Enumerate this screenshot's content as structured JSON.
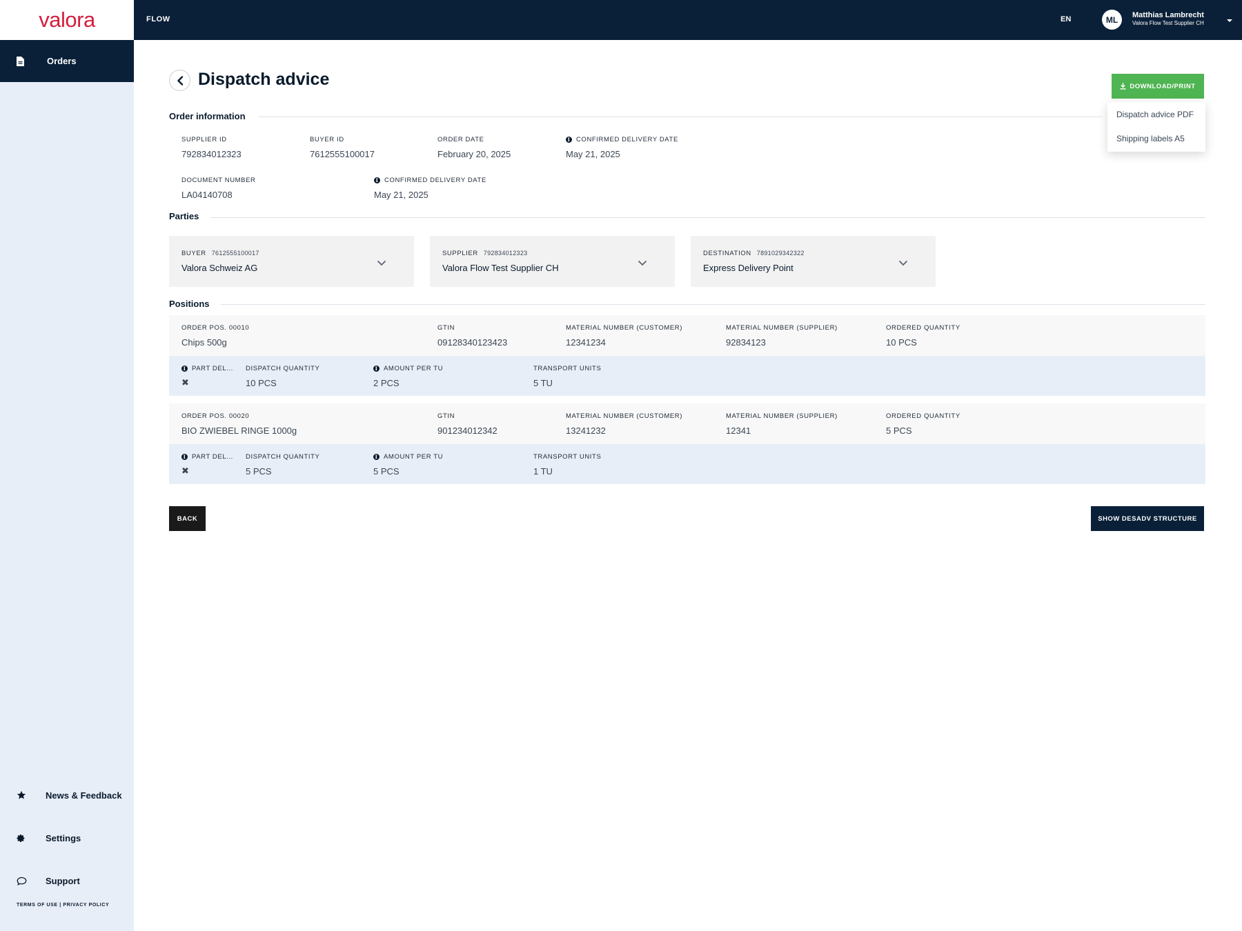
{
  "app": {
    "brand": "valora",
    "section": "FLOW",
    "language": "EN"
  },
  "user": {
    "initials": "ML",
    "name": "Matthias Lambrecht",
    "org": "Valora Flow Test Supplier CH"
  },
  "sidebar": {
    "orders": "Orders",
    "news": "News & Feedback",
    "settings": "Settings",
    "support": "Support",
    "terms": "TERMS OF USE",
    "separator": "|",
    "privacy": "PRIVACY POLICY"
  },
  "page": {
    "title": "Dispatch advice",
    "download_label": "DOWNLOAD/PRINT",
    "dropdown": [
      "Dispatch advice PDF",
      "Shipping labels A5"
    ]
  },
  "order_info": {
    "section_title": "Order information",
    "supplier_id_label": "SUPPLIER ID",
    "supplier_id": "792834012323",
    "buyer_id_label": "BUYER ID",
    "buyer_id": "7612555100017",
    "order_date_label": "ORDER DATE",
    "order_date": "February 20, 2025",
    "confirmed_delivery_label": "CONFIRMED DELIVERY DATE",
    "confirmed_delivery": "May 21, 2025",
    "document_number_label": "DOCUMENT NUMBER",
    "document_number": "LA04140708",
    "confirmed_delivery_label_2": "CONFIRMED DELIVERY DATE",
    "confirmed_delivery_2": "May 21, 2025"
  },
  "parties": {
    "section_title": "Parties",
    "items": [
      {
        "role": "BUYER",
        "id": "7612555100017",
        "name": "Valora Schweiz AG"
      },
      {
        "role": "SUPPLIER",
        "id": "792834012323",
        "name": "Valora Flow Test Supplier CH"
      },
      {
        "role": "DESTINATION",
        "id": "7891029342322",
        "name": "Express Delivery Point"
      }
    ]
  },
  "positions": {
    "section_title": "Positions",
    "labels": {
      "gtin": "GTIN",
      "mat_customer": "MATERIAL NUMBER (CUSTOMER)",
      "mat_supplier": "MATERIAL NUMBER (SUPPLIER)",
      "ordered_qty": "ORDERED QUANTITY",
      "part_delivery": "PART DEL...",
      "dispatch_qty": "DISPATCH QUANTITY",
      "amount_per_tu": "AMOUNT PER TU",
      "transport_units": "TRANSPORT UNITS"
    },
    "items": [
      {
        "pos_label": "ORDER POS. 00010",
        "name": "Chips 500g",
        "gtin": "09128340123423",
        "mat_customer": "12341234",
        "mat_supplier": "92834123",
        "ordered_qty": "10 PCS",
        "part_delivery": "✖",
        "dispatch_qty": "10 PCS",
        "amount_per_tu": "2 PCS",
        "transport_units": "5 TU"
      },
      {
        "pos_label": "ORDER POS. 00020",
        "name": "BIO ZWIEBEL RINGE 1000g",
        "gtin": "901234012342",
        "mat_customer": "13241232",
        "mat_supplier": "12341",
        "ordered_qty": "5 PCS",
        "part_delivery": "✖",
        "dispatch_qty": "5 PCS",
        "amount_per_tu": "5 PCS",
        "transport_units": "1 TU"
      }
    ]
  },
  "actions": {
    "back": "BACK",
    "show_desadv": "SHOW DESADV STRUCTURE"
  },
  "colors": {
    "navy": "#0a2038",
    "brand_red": "#d41e3c",
    "accent_green": "#4fb452",
    "sidebar_bg": "#e8eef8"
  }
}
